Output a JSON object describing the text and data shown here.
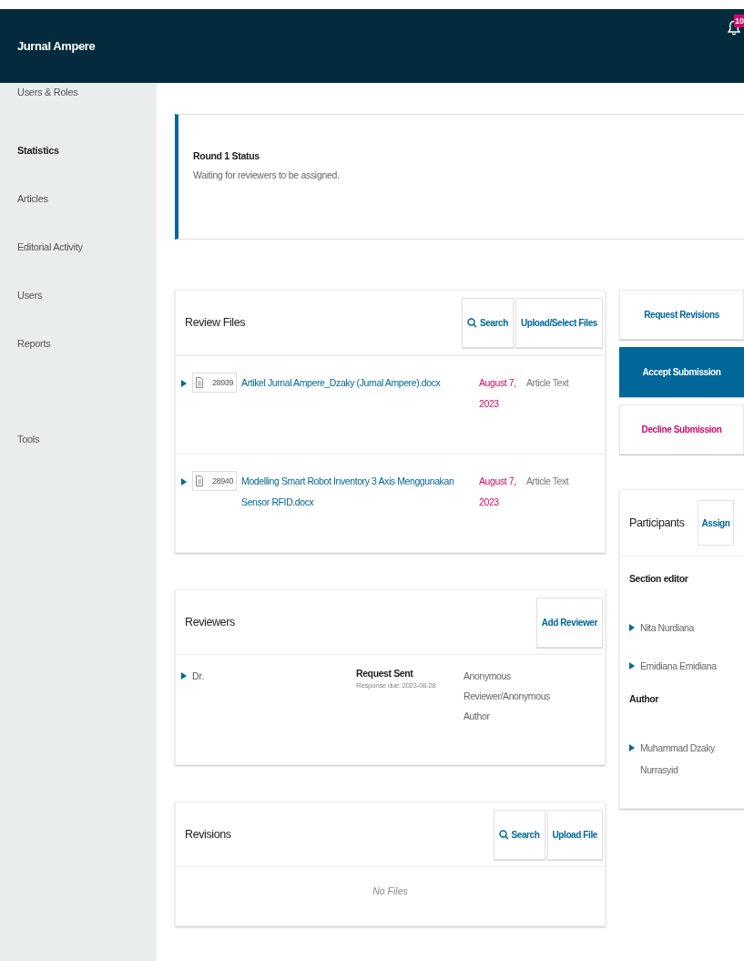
{
  "header": {
    "title": "Jurnal Ampere",
    "notifications": "10"
  },
  "sidebar": {
    "groups": [
      {
        "items": [
          "Users & Roles"
        ]
      },
      {
        "heading": "Statistics",
        "items": [
          "Articles",
          "Editorial Activity",
          "Users",
          "Reports"
        ]
      },
      {
        "items": [
          "Tools"
        ]
      }
    ]
  },
  "status": {
    "title": "Round 1 Status",
    "message": "Waiting for reviewers to be assigned."
  },
  "review_files": {
    "title": "Review Files",
    "actions": [
      {
        "label": "Search",
        "kind": "search"
      },
      {
        "label": "Upload/Select Files",
        "kind": "plain"
      }
    ],
    "rows": [
      {
        "id": "28939",
        "name": "Artikel Jurnal Ampere_Dzaky (Jurnal Ampere).docx",
        "date": "August 7, 2023",
        "type": "Article Text"
      },
      {
        "id": "28940",
        "name": "Modelling Smart Robot Inventory 3 Axis Menggunakan Sensor RFID.docx",
        "date": "August 7, 2023",
        "type": "Article Text"
      }
    ]
  },
  "reviewers": {
    "title": "Reviewers",
    "actions": [
      {
        "label": "Add Reviewer",
        "kind": "plain"
      }
    ],
    "rows": [
      {
        "name": "Dr.",
        "status": "Request Sent",
        "due": "Response due: 2023-08-28",
        "method": "Anonymous Reviewer/Anonymous Author"
      }
    ]
  },
  "revisions": {
    "title": "Revisions",
    "actions": [
      {
        "label": "Search",
        "kind": "search"
      },
      {
        "label": "Upload File",
        "kind": "plain"
      }
    ],
    "empty": "No Files"
  },
  "decisions": [
    {
      "label": "Request Revisions",
      "kind": "default"
    },
    {
      "label": "Accept Submission",
      "kind": "primary"
    },
    {
      "label": "Decline Submission",
      "kind": "danger"
    }
  ],
  "participants": {
    "title": "Participants",
    "action": "Assign",
    "groups": [
      {
        "role": "Section editor",
        "people": [
          "Nita Nurdiana",
          "Emidiana Emidiana"
        ]
      },
      {
        "role": "Author",
        "people": [
          "Muhammad Dzaky Nurrasyid"
        ]
      }
    ]
  }
}
